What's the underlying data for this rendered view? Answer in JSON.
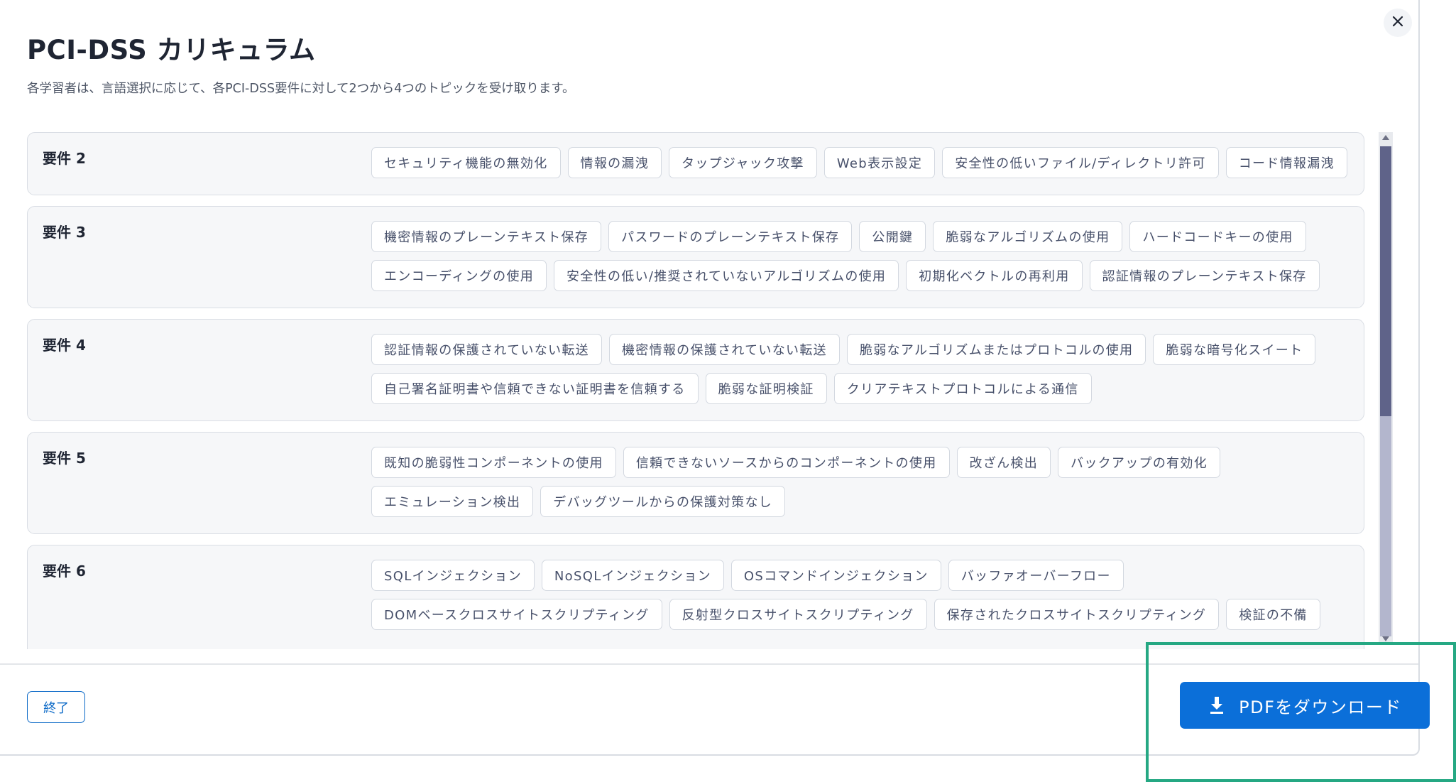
{
  "modal": {
    "title": "PCI-DSS カリキュラム",
    "subtitle": "各学習者は、言語選択に応じて、各PCI-DSS要件に対して2つから4つのトピックを受け取ります。",
    "close_icon": "close-icon"
  },
  "requirements": [
    {
      "label": "要件 2",
      "topics": [
        "セキュリティ機能の無効化",
        "情報の漏洩",
        "タップジャック攻撃",
        "Web表示設定",
        "安全性の低いファイル/ディレクトリ許可",
        "コード情報漏洩"
      ]
    },
    {
      "label": "要件 3",
      "topics": [
        "機密情報のプレーンテキスト保存",
        "パスワードのプレーンテキスト保存",
        "公開鍵",
        "脆弱なアルゴリズムの使用",
        "ハードコードキーの使用",
        "エンコーディングの使用",
        "安全性の低い/推奨されていないアルゴリズムの使用",
        "初期化ベクトルの再利用",
        "認証情報のプレーンテキスト保存"
      ]
    },
    {
      "label": "要件 4",
      "topics": [
        "認証情報の保護されていない転送",
        "機密情報の保護されていない転送",
        "脆弱なアルゴリズムまたはプロトコルの使用",
        "脆弱な暗号化スイート",
        "自己署名証明書や信頼できない証明書を信頼する",
        "脆弱な証明検証",
        "クリアテキストプロトコルによる通信"
      ]
    },
    {
      "label": "要件 5",
      "topics": [
        "既知の脆弱性コンポーネントの使用",
        "信頼できないソースからのコンポーネントの使用",
        "改ざん検出",
        "バックアップの有効化",
        "エミュレーション検出",
        "デバッグツールからの保護対策なし"
      ]
    },
    {
      "label": "要件 6",
      "topics": [
        "SQLインジェクション",
        "NoSQLインジェクション",
        "OSコマンドインジェクション",
        "バッファオーバーフロー",
        "DOMベースクロスサイトスクリプティング",
        "反射型クロスサイトスクリプティング",
        "保存されたクロスサイトスクリプティング",
        "検証の不備"
      ]
    }
  ],
  "footer": {
    "end_label": "終了",
    "pdf_label": "PDFをダウンロード",
    "pdf_icon": "download-icon"
  },
  "colors": {
    "primary": "#0b6fd9",
    "highlight": "#25a883",
    "chip_text": "#47506a",
    "card_bg": "#f6f7f9"
  }
}
